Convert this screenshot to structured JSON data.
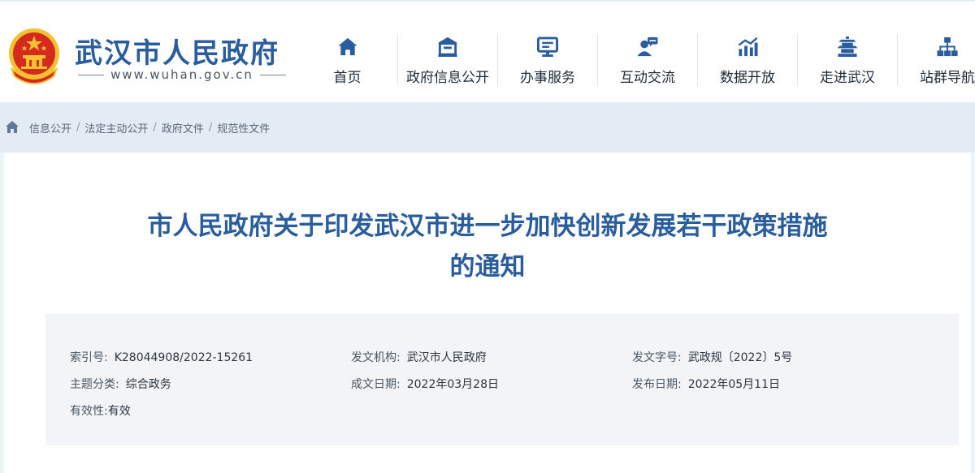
{
  "header": {
    "site_name": "武汉市人民政府",
    "site_url": "www.wuhan.gov.cn",
    "nav": [
      {
        "label": "首页",
        "icon": "home-icon"
      },
      {
        "label": "政府信息公开",
        "icon": "building-icon"
      },
      {
        "label": "办事服务",
        "icon": "monitor-icon"
      },
      {
        "label": "互动交流",
        "icon": "chat-user-icon"
      },
      {
        "label": "数据开放",
        "icon": "chart-icon"
      },
      {
        "label": "走进武汉",
        "icon": "pagoda-icon"
      },
      {
        "label": "站群导航",
        "icon": "sitemap-icon"
      }
    ]
  },
  "breadcrumb": [
    "信息公开",
    "法定主动公开",
    "政府文件",
    "规范性文件"
  ],
  "article": {
    "title_line1": "市人民政府关于印发武汉市进一步加快创新发展若干政策措施",
    "title_line2": "的通知"
  },
  "meta": {
    "index_label": "索引号:",
    "index_value": "K28044908/2022-15261",
    "issuer_label": "发文机构:",
    "issuer_value": "武汉市人民政府",
    "doc_no_label": "发文字号:",
    "doc_no_value": "武政规〔2022〕5号",
    "topic_label": "主题分类:",
    "topic_value": "综合政务",
    "date_written_label": "成文日期:",
    "date_written_value": "2022年03月28日",
    "date_published_label": "发布日期:",
    "date_published_value": "2022年05月11日",
    "validity_label": "有效性:",
    "validity_value": "有效"
  },
  "colors": {
    "brand_blue": "#2a5d9e",
    "emblem_red": "#d62a1e",
    "emblem_gold": "#f2c230"
  }
}
